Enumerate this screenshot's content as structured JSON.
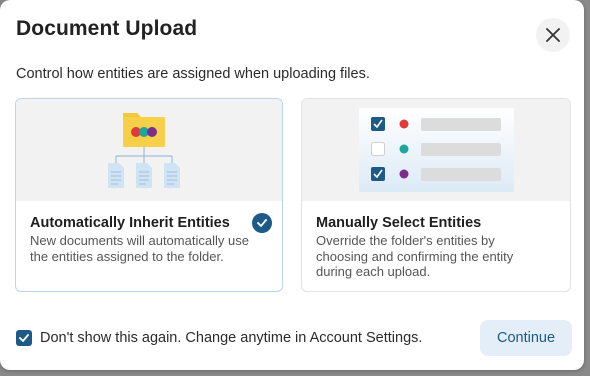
{
  "dialog": {
    "title": "Document Upload",
    "subtitle": "Control how entities are assigned when uploading files."
  },
  "options": [
    {
      "title": "Automatically Inherit Entities",
      "description": "New documents will automatically use the entities assigned to the folder.",
      "selected": true
    },
    {
      "title": "Manually Select Entities",
      "description": "Override the folder's entities by choosing and confirming the entity during each upload.",
      "selected": false,
      "illustration_rows": [
        {
          "checked": true,
          "dot_color": "#e03a3a"
        },
        {
          "checked": false,
          "dot_color": "#1aa89a"
        },
        {
          "checked": true,
          "dot_color": "#7b2d8e"
        }
      ]
    }
  ],
  "footer": {
    "dont_show_label": "Don't show this again. Change anytime in Account Settings.",
    "dont_show_checked": true,
    "continue_label": "Continue"
  },
  "colors": {
    "accent": "#1d5a86",
    "folder": "#f5c838",
    "document": "#cfe3f3"
  },
  "icons": {
    "close": "close-icon",
    "folder": "folder-icon",
    "checkmark": "checkmark-icon"
  }
}
